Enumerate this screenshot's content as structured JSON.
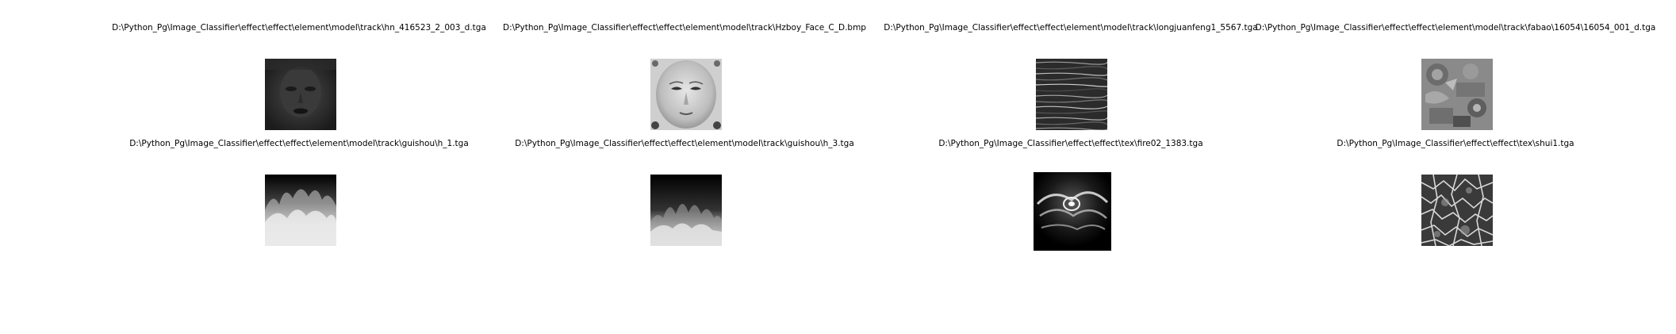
{
  "window": {
    "background": "#ffffff"
  },
  "grid": {
    "rows": 2,
    "columns": 4,
    "cells": [
      {
        "title": "D:\\Python_Pg\\Image_Classifier\\effect\\effect\\element\\model\\track\\hn_416523_2_003_d.tga",
        "icon": "dark-face-texture"
      },
      {
        "title": "D:\\Python_Pg\\Image_Classifier\\effect\\effect\\element\\model\\track\\Hzboy_Face_C_D.bmp",
        "icon": "grey-face-texture"
      },
      {
        "title": "D:\\Python_Pg\\Image_Classifier\\effect\\effect\\element\\model\\track\\longjuanfeng1_5567.tga",
        "icon": "streak-texture"
      },
      {
        "title": "D:\\Python_Pg\\Image_Classifier\\effect\\effect\\element\\model\\track\\fabao\\16054\\16054_001_d.tga",
        "icon": "mixed-atlas-texture"
      },
      {
        "title": "D:\\Python_Pg\\Image_Classifier\\effect\\effect\\element\\model\\track\\guishou\\h_1.tga",
        "icon": "fire-gradient-texture"
      },
      {
        "title": "D:\\Python_Pg\\Image_Classifier\\effect\\effect\\element\\model\\track\\guishou\\h_3.tga",
        "icon": "fire-gradient-texture"
      },
      {
        "title": "D:\\Python_Pg\\Image_Classifier\\effect\\effect\\tex\\fire02_1383.tga",
        "icon": "swirl-fire-texture"
      },
      {
        "title": "D:\\Python_Pg\\Image_Classifier\\effect\\effect\\tex\\shui1.tga",
        "icon": "water-caustic-texture"
      }
    ]
  }
}
